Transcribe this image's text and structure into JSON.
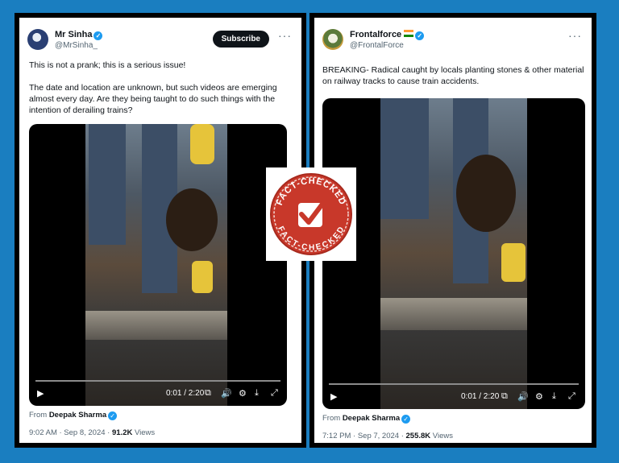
{
  "left_tweet": {
    "name": "Mr Sinha",
    "handle": "@MrSinha_",
    "subscribe_label": "Subscribe",
    "more_label": "···",
    "text_line1": "This is not a prank; this is a serious issue!",
    "text_line2": "The date and location are unknown, but such videos are emerging almost every day. Are they being taught to do such things with the intention of derailing trains?",
    "video_time": "0:01 / 2:20",
    "from_prefix": "From",
    "from_name": "Deepak Sharma",
    "timestamp": "9:02 AM · Sep 8, 2024 · ",
    "views_count": "91.2K",
    "views_label": " Views"
  },
  "right_tweet": {
    "name": "Frontalforce",
    "handle": "@FrontalForce",
    "more_label": "···",
    "text": "BREAKING- Radical caught by locals planting stones & other material on railway tracks to cause train accidents.",
    "video_time": "0:01 / 2:20",
    "from_prefix": "From",
    "from_name": "Deepak Sharma",
    "timestamp": "7:12 PM · Sep 7, 2024 · ",
    "views_count": "255.8K",
    "views_label": " Views"
  },
  "stamp": {
    "top_text": "FACT-CHECKED",
    "bottom_text": "FACT-CHECKED"
  },
  "colors": {
    "frame_blue": "#1a7ec0",
    "verified_blue": "#1d9bf0",
    "stamp_red": "#c8382a"
  },
  "icons": [
    "verified-badge-icon",
    "more-icon",
    "play-icon",
    "captions-icon",
    "volume-icon",
    "settings-icon",
    "pip-icon",
    "fullscreen-icon",
    "checkmark-icon"
  ]
}
